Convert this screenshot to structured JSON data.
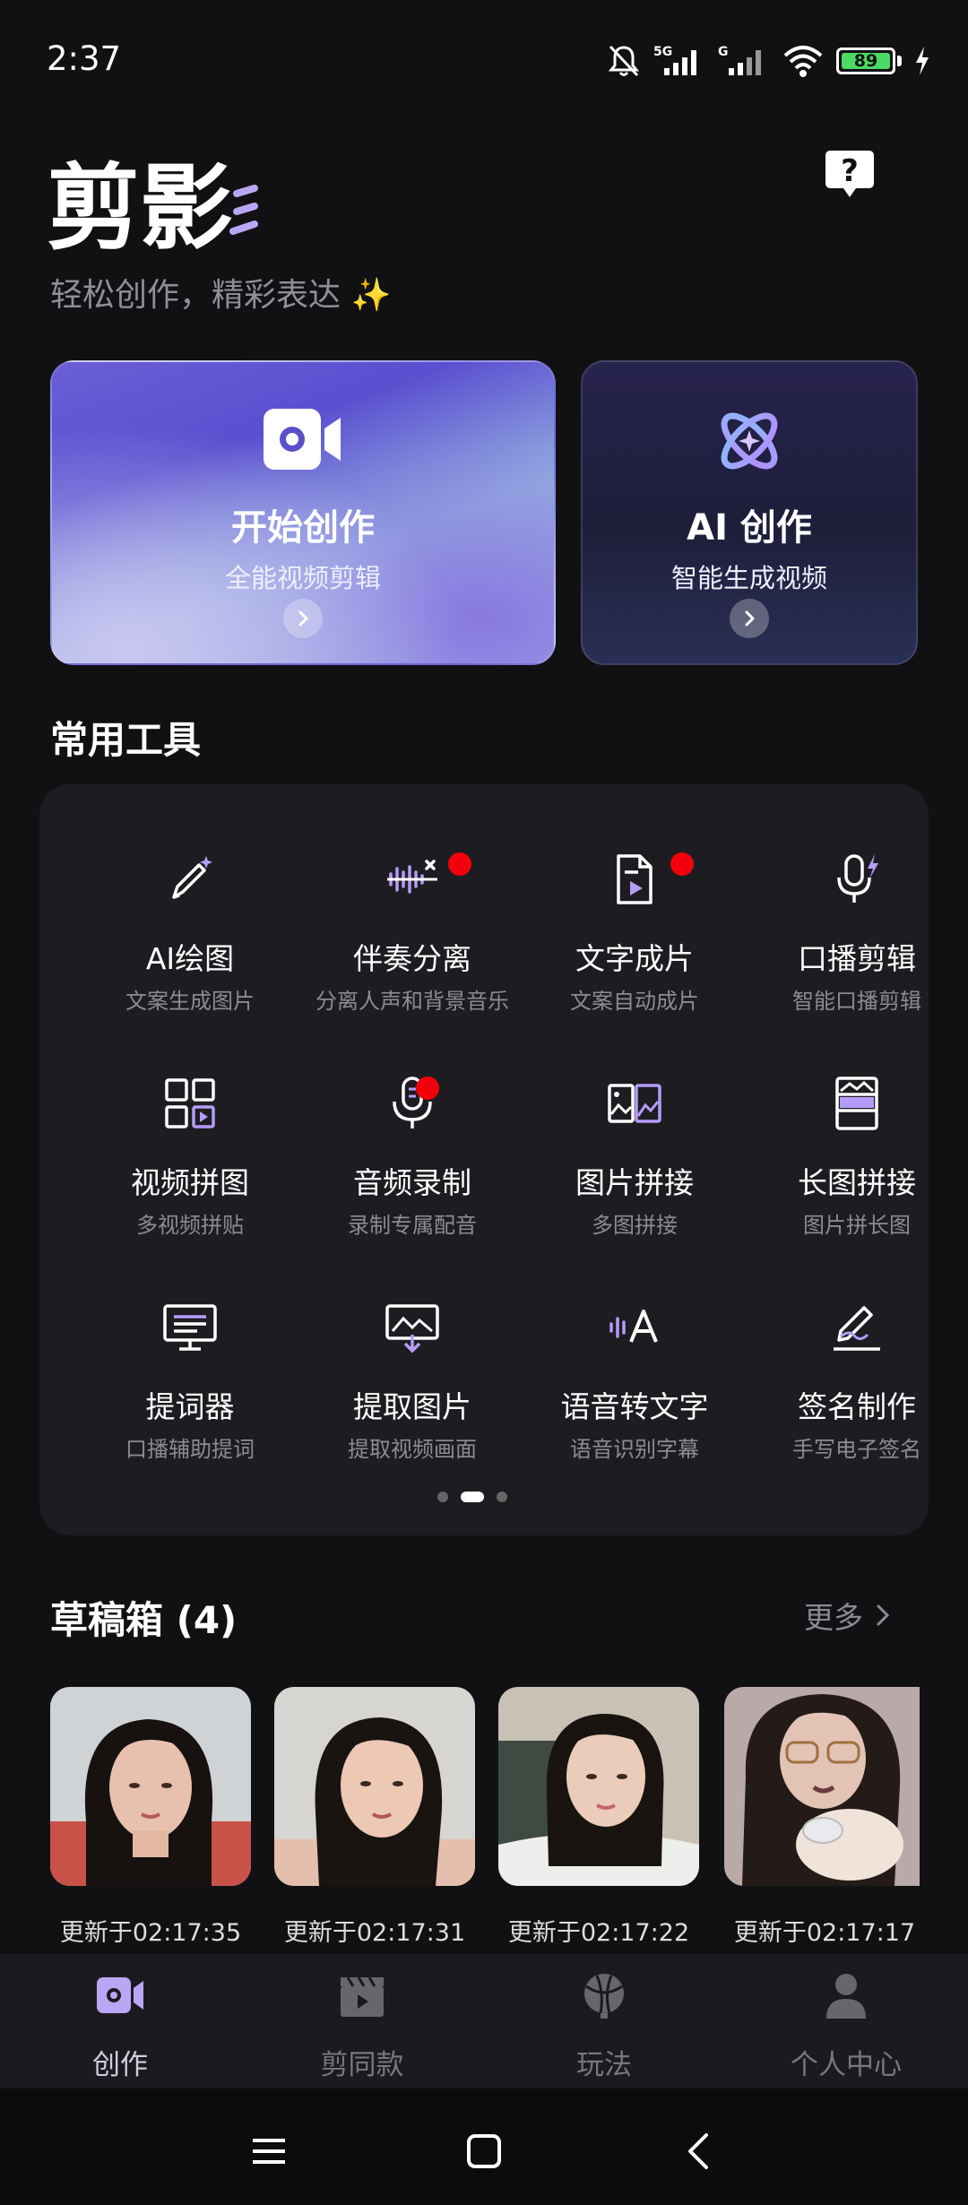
{
  "status_bar": {
    "time": "2:37",
    "network_1": "5G",
    "network_2": "G",
    "battery": "89"
  },
  "header": {
    "logo_text": "剪影",
    "tagline": "轻松创作，精彩表达 ✨"
  },
  "hero_cards": [
    {
      "title": "开始创作",
      "subtitle": "全能视频剪辑",
      "icon": "video-camera-icon"
    },
    {
      "title": "AI 创作",
      "subtitle": "智能生成视频",
      "icon": "atom-sparkle-icon"
    }
  ],
  "tools": {
    "title": "常用工具",
    "items": [
      {
        "label": "AI绘图",
        "sub": "文案生成图片",
        "icon": "pen-sparkle-icon",
        "badge": false
      },
      {
        "label": "伴奏分离",
        "sub": "分离人声和背景音乐",
        "icon": "waveform-split-icon",
        "badge": true
      },
      {
        "label": "文字成片",
        "sub": "文案自动成片",
        "icon": "document-play-icon",
        "badge": true
      },
      {
        "label": "口播剪辑",
        "sub": "智能口播剪辑",
        "icon": "microphone-bolt-icon",
        "badge": false
      },
      {
        "label": "视频拼图",
        "sub": "多视频拼贴",
        "icon": "grid-collage-icon",
        "badge": false
      },
      {
        "label": "音频录制",
        "sub": "录制专属配音",
        "icon": "microphone-icon",
        "badge": true
      },
      {
        "label": "图片拼接",
        "sub": "多图拼接",
        "icon": "image-pair-icon",
        "badge": false
      },
      {
        "label": "长图拼接",
        "sub": "图片拼长图",
        "icon": "long-image-icon",
        "badge": false
      },
      {
        "label": "提词器",
        "sub": "口播辅助提词",
        "icon": "teleprompter-icon",
        "badge": false
      },
      {
        "label": "提取图片",
        "sub": "提取视频画面",
        "icon": "extract-frame-icon",
        "badge": false
      },
      {
        "label": "语音转文字",
        "sub": "语音识别字幕",
        "icon": "speech-to-text-icon",
        "badge": false
      },
      {
        "label": "签名制作",
        "sub": "手写电子签名",
        "icon": "signature-pen-icon",
        "badge": false
      }
    ],
    "pager": {
      "pages": 3,
      "active_page": 2
    }
  },
  "drafts": {
    "title": "草稿箱 (4)",
    "more_label": "更多",
    "items": [
      {
        "time": "更新于02:17:35"
      },
      {
        "time": "更新于02:17:31"
      },
      {
        "time": "更新于02:17:22"
      },
      {
        "time": "更新于02:17:17"
      }
    ]
  },
  "bottom_nav": {
    "items": [
      {
        "label": "创作",
        "icon": "video-camera-icon",
        "active": true
      },
      {
        "label": "剪同款",
        "icon": "clapperboard-icon",
        "active": false
      },
      {
        "label": "玩法",
        "icon": "planet-icon",
        "active": false
      },
      {
        "label": "个人中心",
        "icon": "person-icon",
        "active": false
      }
    ]
  },
  "colors": {
    "background": "#111114",
    "panel": "#1d1d21",
    "accent": "#9b87f5",
    "badge": "#f2000b"
  }
}
